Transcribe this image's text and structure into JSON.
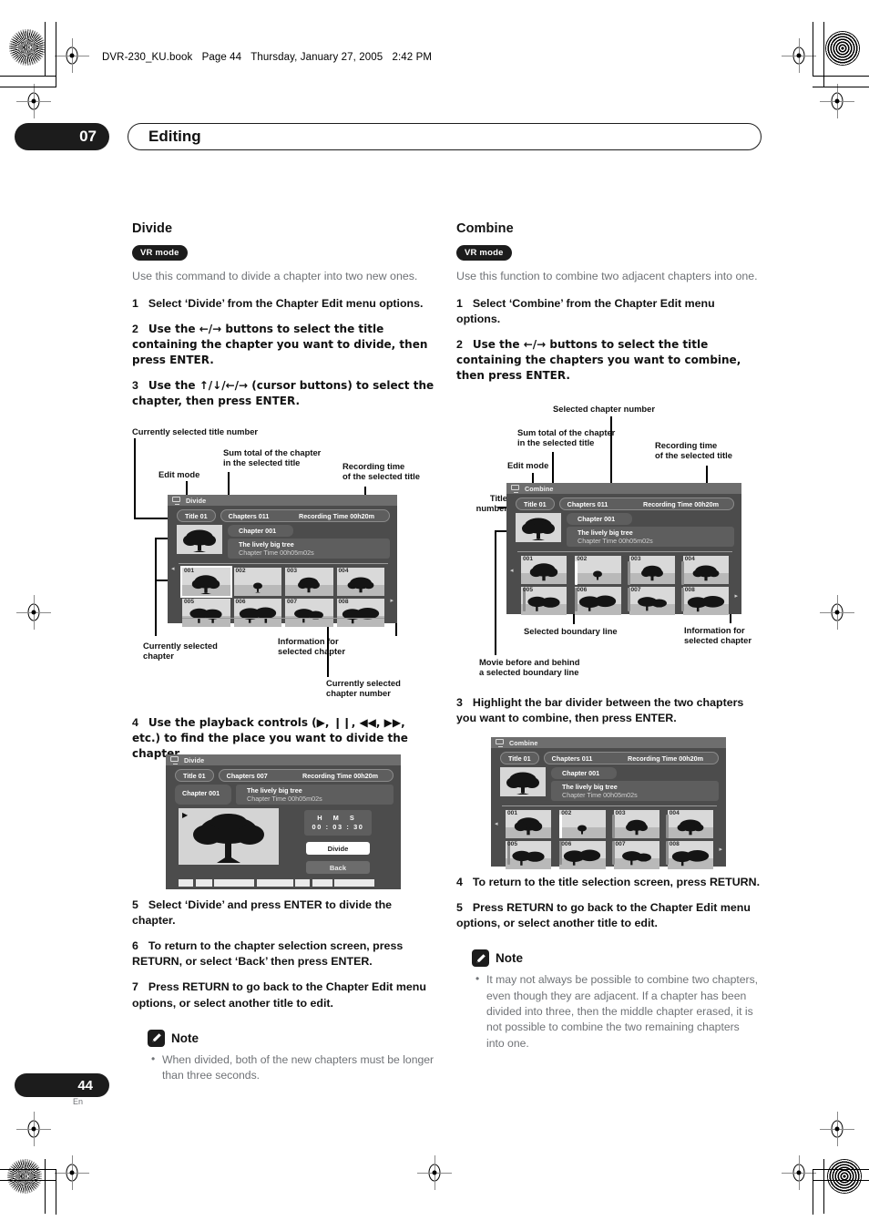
{
  "header": {
    "book_line": [
      "DVR-230_KU.book",
      "Page 44",
      "Thursday, January 27, 2005",
      "2:42 PM"
    ],
    "chapter_number": "07",
    "chapter_title": "Editing"
  },
  "footer": {
    "page_number": "44",
    "language": "En"
  },
  "left_column": {
    "heading": "Divide",
    "badge": "VR mode",
    "intro": "Use this command to divide a chapter into two new ones.",
    "steps": [
      {
        "n": "1",
        "text": "Select ‘Divide’ from the Chapter Edit menu options."
      },
      {
        "n": "2",
        "text": "Use the ←/→ buttons to select the title containing the chapter you want to divide, then press ENTER."
      },
      {
        "n": "3",
        "text": "Use the ↑/↓/←/→ (cursor buttons) to select the chapter, then press ENTER."
      },
      {
        "n": "4",
        "text": "Use the playback controls (▶, ❙❙, ◀◀, ▶▶, etc.) to find the place you want to divide the chapter."
      },
      {
        "n": "5",
        "text": "Select ‘Divide’ and press ENTER to divide the chapter."
      },
      {
        "n": "6",
        "text": "To return to the chapter selection screen, press RETURN, or select ‘Back’ then press ENTER."
      },
      {
        "n": "7",
        "text": "Press RETURN to go back to the Chapter Edit menu options, or select another title to edit."
      }
    ],
    "note": {
      "label": "Note",
      "items": [
        "When divided, both of the new chapters must be longer than three seconds."
      ]
    },
    "callouts": {
      "title_number": "Currently selected title number",
      "edit_mode": "Edit mode",
      "chapter_sum": "Sum total of the chapter\nin the selected title",
      "recording_time": "Recording time\nof the selected title",
      "current_chapter": "Currently selected\nchapter",
      "chapter_info": "Information for\nselected chapter",
      "chapter_number": "Currently selected\nchapter number"
    }
  },
  "right_column": {
    "heading": "Combine",
    "badge": "VR mode",
    "intro": "Use this function to combine two adjacent chapters into one.",
    "steps": [
      {
        "n": "1",
        "text": "Select ‘Combine’ from the Chapter Edit menu options."
      },
      {
        "n": "2",
        "text": "Use the ←/→ buttons to select the title containing the chapters you want to combine, then press ENTER."
      },
      {
        "n": "3",
        "text": "Highlight the bar divider between the two chapters you want to combine, then press ENTER."
      },
      {
        "n": "4",
        "text": "To return to the title selection screen, press RETURN."
      },
      {
        "n": "5",
        "text": "Press RETURN to go back to the Chapter Edit menu options, or select another title to edit."
      }
    ],
    "note": {
      "label": "Note",
      "items": [
        "It may not always be possible to combine two chapters, even though they are adjacent. If a chapter has been divided into three, then the middle chapter erased, it is not possible to combine the two remaining chapters into one."
      ]
    },
    "callouts": {
      "selected_chapter_number": "Selected chapter number",
      "chapter_sum": "Sum total of the chapter\nin the selected title",
      "recording_time": "Recording time\nof the selected title",
      "edit_mode": "Edit mode",
      "title_number": "Title\nnumber",
      "boundary_line": "Selected boundary line",
      "movie_around": "Movie before and behind\na selected boundary line",
      "chapter_info": "Information for\nselected chapter"
    }
  },
  "screens": {
    "divide_chapter_select": {
      "mode": "Divide",
      "title": "Title 01",
      "chapters": "Chapters 011",
      "rec_time": "Recording Time  00h20m",
      "chapter_label": "Chapter 001",
      "chapter_name": "The lively big tree",
      "chapter_time": "Chapter Time  00h05m02s",
      "thumbs": [
        "001",
        "002",
        "003",
        "004",
        "005",
        "006",
        "007",
        "008"
      ],
      "selected_thumb": "001",
      "nav_left": "◂",
      "nav_right": "▸"
    },
    "divide_playback": {
      "mode": "Divide",
      "title": "Title 01",
      "chapters": "Chapters 007",
      "rec_time": "Recording Time  00h20m",
      "chapter_label": "Chapter 001",
      "chapter_name": "The lively big tree",
      "chapter_time": "Chapter Time  00h05m02s",
      "time_header": "H   M   S",
      "time_value": "00 : 03 : 30",
      "divide_button": "Divide",
      "back_button": "Back",
      "play_icon": "▶"
    },
    "combine_chapter_select": {
      "mode": "Combine",
      "title": "Title 01",
      "chapters": "Chapters 011",
      "rec_time": "Recording Time  00h20m",
      "chapter_label": "Chapter 001",
      "chapter_name": "The lively big tree",
      "chapter_time": "Chapter Time  00h05m02s",
      "thumbs": [
        "001",
        "002",
        "003",
        "004",
        "005",
        "006",
        "007",
        "008"
      ],
      "nav_left": "◂",
      "nav_right": "▸"
    },
    "combine_result": {
      "mode": "Combine",
      "title": "Title 01",
      "chapters": "Chapters 011",
      "rec_time": "Recording Time  00h20m",
      "chapter_label": "Chapter 001",
      "chapter_name": "The lively big tree",
      "chapter_time": "Chapter Time  00h05m02s",
      "thumbs": [
        "001",
        "002",
        "003",
        "004",
        "005",
        "006",
        "007",
        "008"
      ],
      "nav_left": "◂",
      "nav_right": "▸"
    }
  },
  "colors": {
    "ui_bg": "#4c4c4c",
    "ui_bar": "#6e6e6e",
    "accent_dark": "#1c1c1c",
    "muted_text": "#6f7276"
  }
}
